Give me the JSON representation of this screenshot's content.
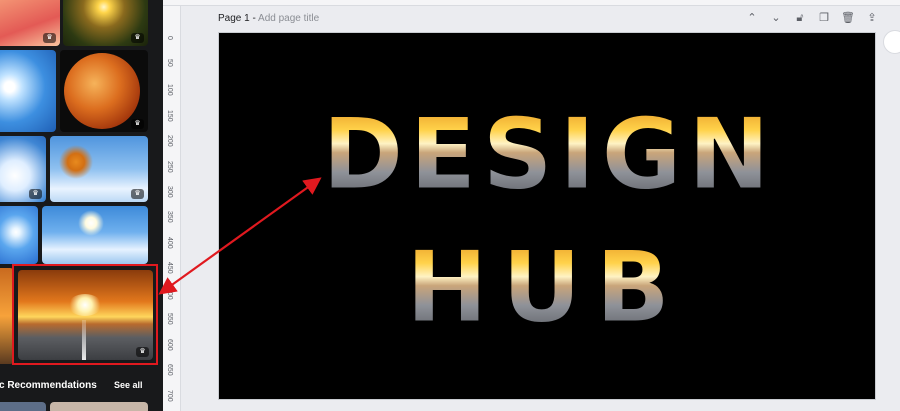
{
  "sidebar": {
    "recommendations_title": "c Recommendations",
    "see_all": "See all"
  },
  "ruler": {
    "ticks": [
      "0",
      "50",
      "100",
      "150",
      "200",
      "250",
      "300",
      "350",
      "400",
      "450",
      "500",
      "550",
      "600",
      "650",
      "700"
    ]
  },
  "page": {
    "label": "Page 1 - ",
    "title_placeholder": "Add page title"
  },
  "design": {
    "line1": "DESIGN",
    "line2": "HUB"
  },
  "colors": {
    "panel": "#18191b",
    "selection": "#e0191f",
    "arrow": "#e0191f",
    "canvas": "#000000"
  }
}
